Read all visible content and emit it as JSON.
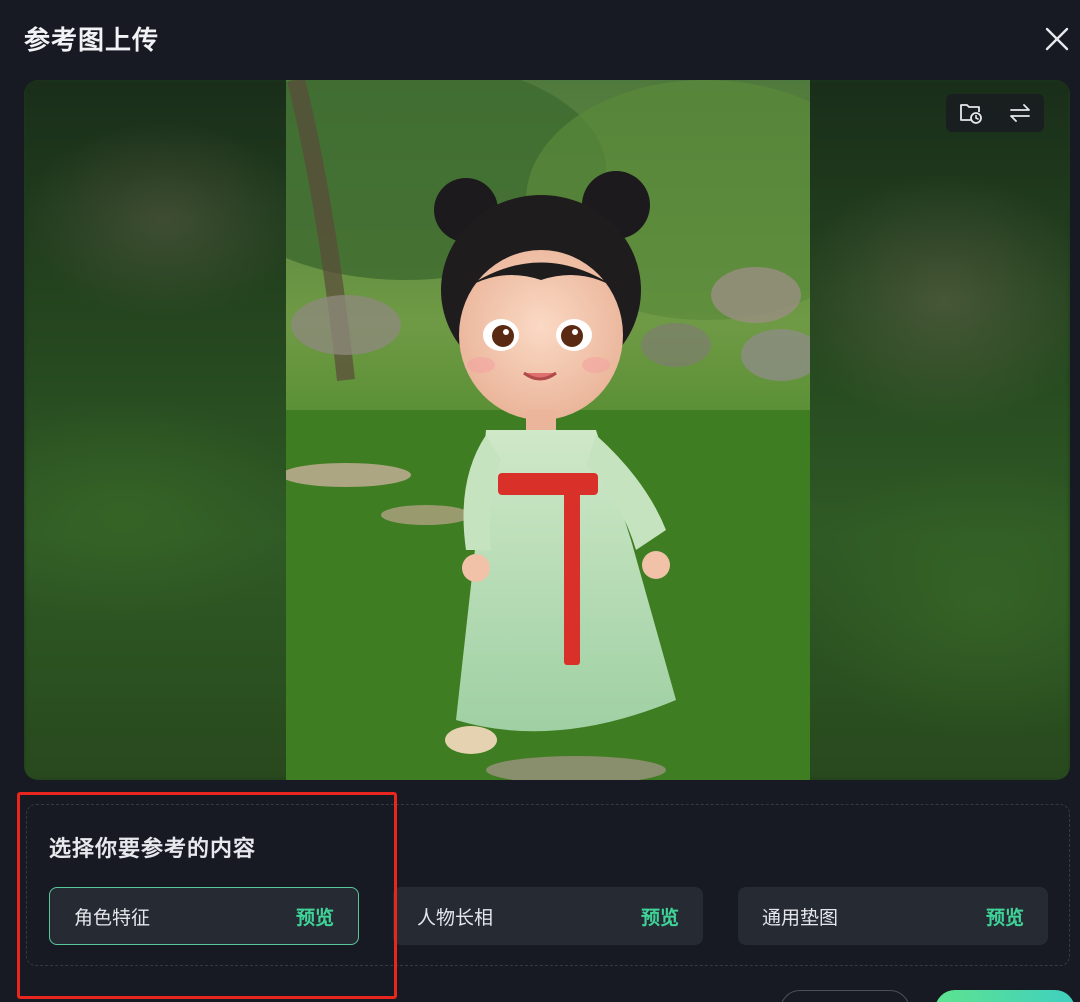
{
  "dialog": {
    "title": "参考图上传"
  },
  "image": {
    "subject": "cartoon girl in green hanfu on grass"
  },
  "icons": {
    "close": "close-icon",
    "folder_history": "folder-history-icon",
    "swap": "swap-icon"
  },
  "reference": {
    "heading": "选择你要参考的内容",
    "options": [
      {
        "label": "角色特征",
        "preview": "预览",
        "selected": true
      },
      {
        "label": "人物长相",
        "preview": "预览",
        "selected": false
      },
      {
        "label": "通用垫图",
        "preview": "预览",
        "selected": false
      }
    ]
  },
  "colors": {
    "background": "#171a22",
    "accent": "#3fd398",
    "highlight": "#e8261d"
  }
}
